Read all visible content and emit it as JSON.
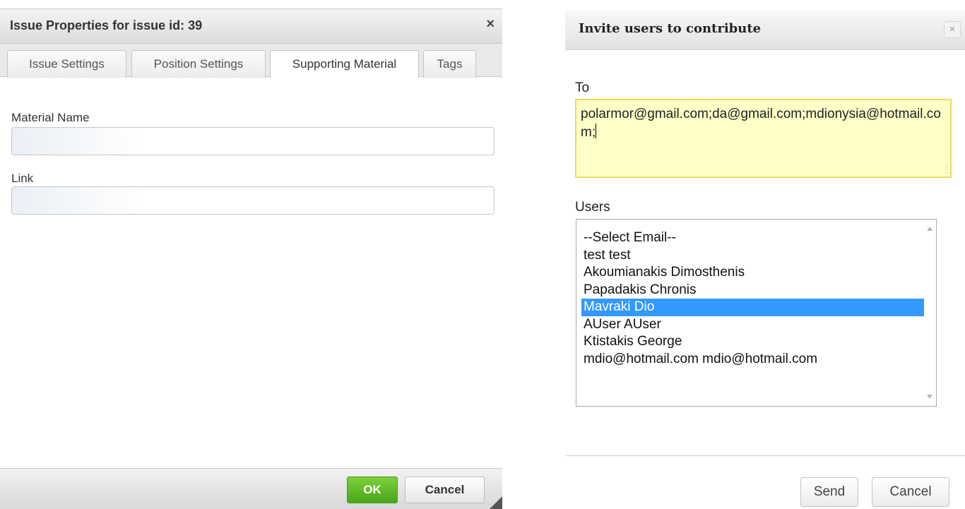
{
  "issue_dialog": {
    "title": "Issue Properties for issue id: 39",
    "close_glyph": "×",
    "tabs": [
      {
        "label": "Issue Settings",
        "active": false
      },
      {
        "label": "Position Settings",
        "active": false
      },
      {
        "label": "Supporting Material",
        "active": true
      },
      {
        "label": "Tags",
        "active": false
      }
    ],
    "material_name_label": "Material Name",
    "material_name_value": "",
    "link_label": "Link",
    "link_value": "",
    "ok_label": "OK",
    "cancel_label": "Cancel",
    "colors": {
      "ok_button": "#5cb82a"
    }
  },
  "invite_dialog": {
    "title": "Invite users to contribute",
    "close_glyph": "×",
    "to_label": "To",
    "to_value": "polarmor@gmail.com;da@gmail.com;mdionysia@hotmail.com;",
    "users_label": "Users",
    "users": [
      {
        "label": "--Select Email--",
        "selected": false
      },
      {
        "label": "test test",
        "selected": false
      },
      {
        "label": "Akoumianakis Dimosthenis",
        "selected": false
      },
      {
        "label": "Papadakis Chronis",
        "selected": false
      },
      {
        "label": "Mavraki Dio",
        "selected": true
      },
      {
        "label": "AUser AUser",
        "selected": false
      },
      {
        "label": "Ktistakis George",
        "selected": false
      },
      {
        "label": "mdio@hotmail.com mdio@hotmail.com",
        "selected": false
      }
    ],
    "send_label": "Send",
    "cancel_label": "Cancel",
    "colors": {
      "to_background": "#ffffc8",
      "selection": "#3399ff"
    }
  }
}
